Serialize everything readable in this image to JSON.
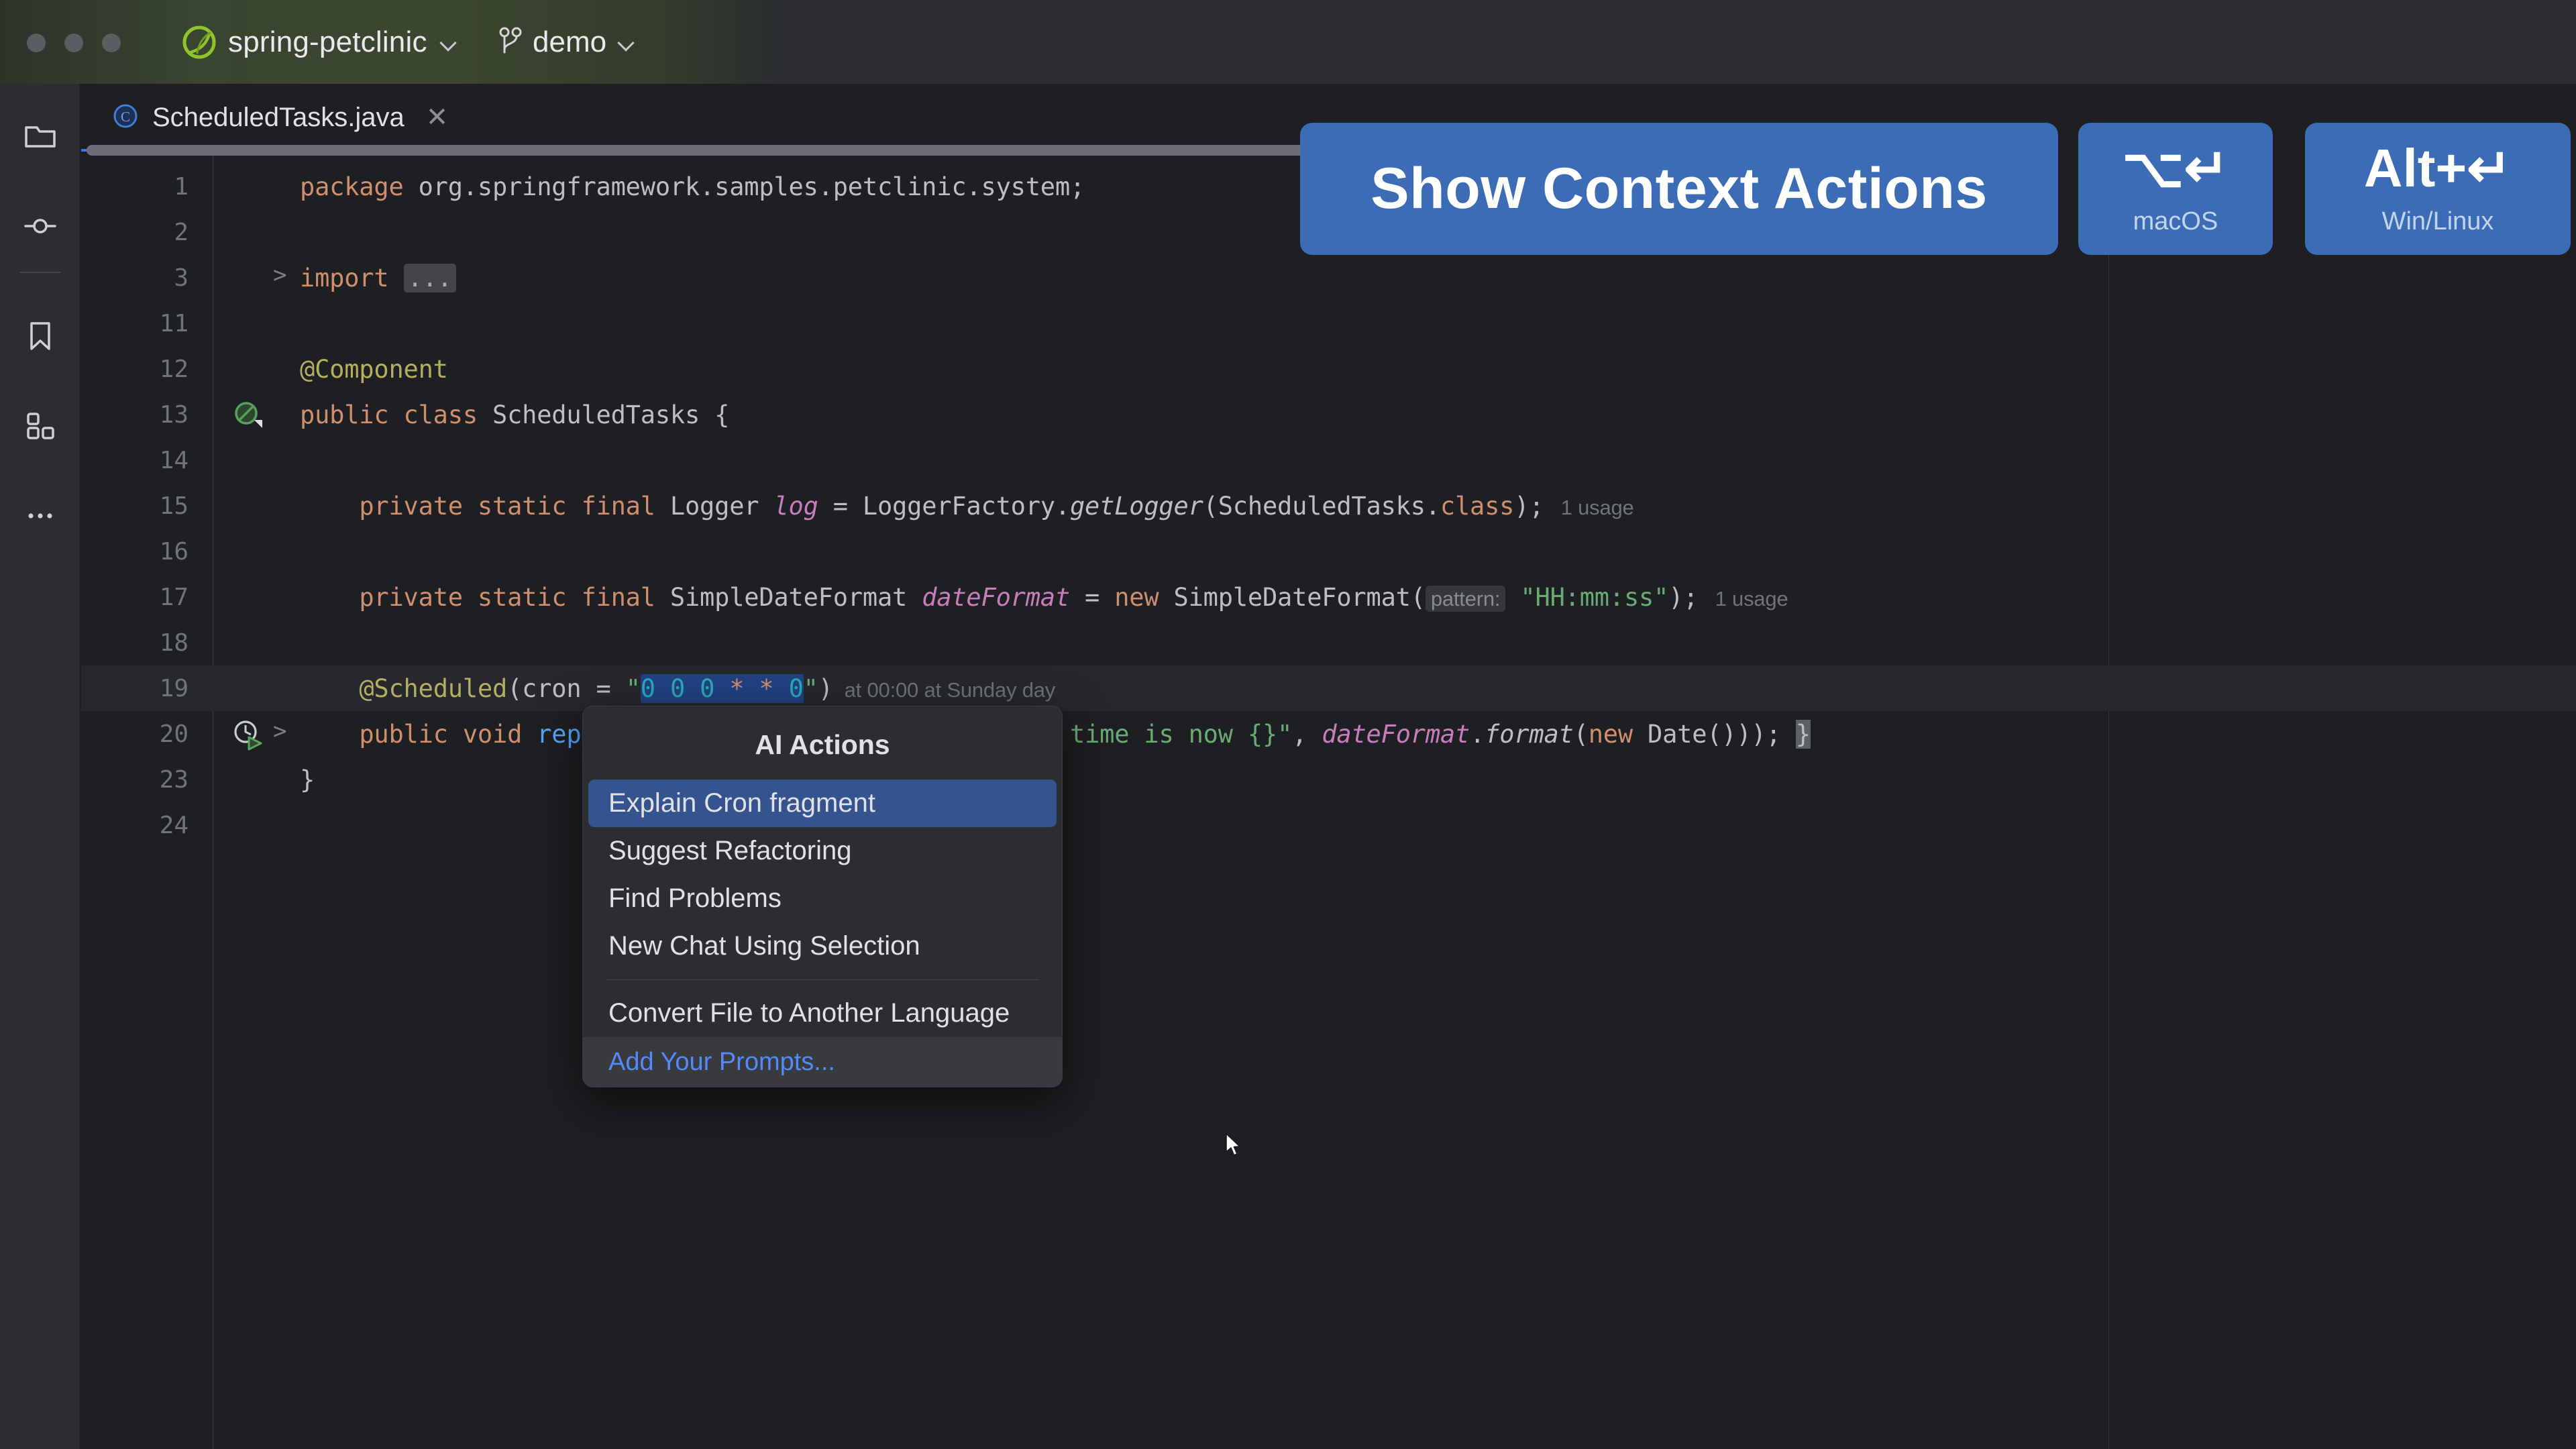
{
  "window": {
    "traffic_lights": [
      "close",
      "minimize",
      "zoom"
    ],
    "project_name": "spring-petclinic",
    "branch_name": "demo",
    "project_icon": "spring-leaf-icon",
    "branch_icon": "git-branch-icon"
  },
  "sidebar": {
    "items": [
      {
        "name": "project",
        "icon": "folder-icon"
      },
      {
        "name": "commit",
        "icon": "commit-icon"
      },
      {
        "name": "bookmarks",
        "icon": "bookmark-icon"
      },
      {
        "name": "structure",
        "icon": "structure-icon"
      },
      {
        "name": "more",
        "icon": "more-dots-icon"
      }
    ]
  },
  "editor": {
    "tab": {
      "label": "ScheduledTasks.java",
      "icon": "java-class-icon",
      "close_icon": "close-icon"
    },
    "lines": [
      {
        "num": "1",
        "fold": "",
        "gutter": "",
        "html": "<span class='kw'>package</span><span class='txt'> org.springframework.samples.petclinic.system;</span>"
      },
      {
        "num": "2",
        "fold": "",
        "gutter": "",
        "html": ""
      },
      {
        "num": "3",
        "fold": ">",
        "gutter": "",
        "html": "<span class='kw'>import</span><span class='txt'> </span><span class='ellipsis-fold'>...</span>"
      },
      {
        "num": "11",
        "fold": "",
        "gutter": "",
        "html": ""
      },
      {
        "num": "12",
        "fold": "",
        "gutter": "",
        "html": "<span class='ann'>@Component</span>"
      },
      {
        "num": "13",
        "fold": "",
        "gutter": "spring-bean-icon",
        "html": "<span class='kw'>public class </span><span class='cls'>ScheduledTasks </span><span class='txt'>{</span>"
      },
      {
        "num": "14",
        "fold": "",
        "gutter": "",
        "html": ""
      },
      {
        "num": "15",
        "fold": "",
        "gutter": "",
        "html": "<span class='txt'>    </span><span class='kw'>private static final </span><span class='cls'>Logger </span><span class='fld'>log</span><span class='txt'> = LoggerFactory.</span><span class='mth'>getLogger</span><span class='txt'>(ScheduledTasks.</span><span class='kw'>class</span><span class='txt'>);</span><span class='hint'>   1 usage</span>"
      },
      {
        "num": "16",
        "fold": "",
        "gutter": "",
        "html": ""
      },
      {
        "num": "17",
        "fold": "",
        "gutter": "",
        "html": "<span class='txt'>    </span><span class='kw'>private static final </span><span class='cls'>SimpleDateFormat </span><span class='fld'>dateFormat</span><span class='txt'> = </span><span class='kw'>new </span><span class='cls'>SimpleDateFormat</span><span class='txt'>(</span><span class='param-hint'>pattern:</span><span class='txt'> </span><span class='str'>\"HH:mm:ss\"</span><span class='txt'>);</span><span class='hint'>   1 usage</span>"
      },
      {
        "num": "18",
        "fold": "",
        "gutter": "",
        "html": ""
      },
      {
        "num": "19",
        "fold": "",
        "gutter": "",
        "current": true,
        "html": "<span class='txt'>    </span><span class='ann'>@Scheduled</span><span class='txt'>(</span><span class='cls'>cron</span><span class='txt'> = </span><span class='str'>\"</span><span class='cron-sel'><span class='num'>0</span><span class='str'> </span><span class='num'>0</span><span class='str'> </span><span class='num'>0</span><span class='str'> </span><span class='kw'>*</span><span class='str'> </span><span class='kw'>*</span><span class='str'> </span><span class='num'>0</span></span><span class='str'>\"</span><span class='txt'>)</span><span class='hint'>  at 00:00 at Sunday day</span>"
      },
      {
        "num": "20",
        "fold": ">",
        "gutter": "scheduled-run-icon",
        "html": "<span class='txt'>    </span><span class='kw'>public void </span><span class='mname'>reportCurrentTime</span><span class='txt'>() { </span><span class='fld'>log</span><span class='txt'>.</span><span class='mth'>info</span><span class='txt'>(</span><span class='str'>\"The time is now {}\"</span><span class='txt'>, </span><span class='fld'>dateFormat</span><span class='txt'>.</span><span class='mth'>format</span><span class='txt'>(</span><span class='kw'>new </span><span class='cls'>Date</span><span class='txt'>())); </span><span class='caret-blk'>}</span>"
      },
      {
        "num": "23",
        "fold": "",
        "gutter": "",
        "html": "<span class='txt'>}</span>"
      },
      {
        "num": "24",
        "fold": "",
        "gutter": "",
        "html": ""
      }
    ]
  },
  "ai_popup": {
    "title": "AI Actions",
    "items": [
      {
        "label": "Explain Cron fragment",
        "selected": true
      },
      {
        "label": "Suggest Refactoring",
        "selected": false
      },
      {
        "label": "Find Problems",
        "selected": false
      },
      {
        "label": "New Chat Using Selection",
        "selected": false
      }
    ],
    "secondary": [
      {
        "label": "Convert File to Another Language"
      }
    ],
    "footer_label": "Add Your Prompts..."
  },
  "overlay": {
    "action_label": "Show Context Actions",
    "shortcuts": [
      {
        "keys": "⌥↵",
        "os": "macOS"
      },
      {
        "keys": "Alt+↵",
        "os": "Win/Linux"
      }
    ],
    "accent_color": "#3b6cb5"
  },
  "colors": {
    "editor_bg": "#1e1f22",
    "chrome_bg": "#2b2d30",
    "accent_blue": "#3574f0",
    "selection_blue": "#35538f",
    "keyword_orange": "#cf8e6d",
    "string_green": "#6aab73",
    "annotation_olive": "#b3ae60",
    "field_purple": "#c77dbb",
    "number_cyan": "#2aacb8"
  }
}
